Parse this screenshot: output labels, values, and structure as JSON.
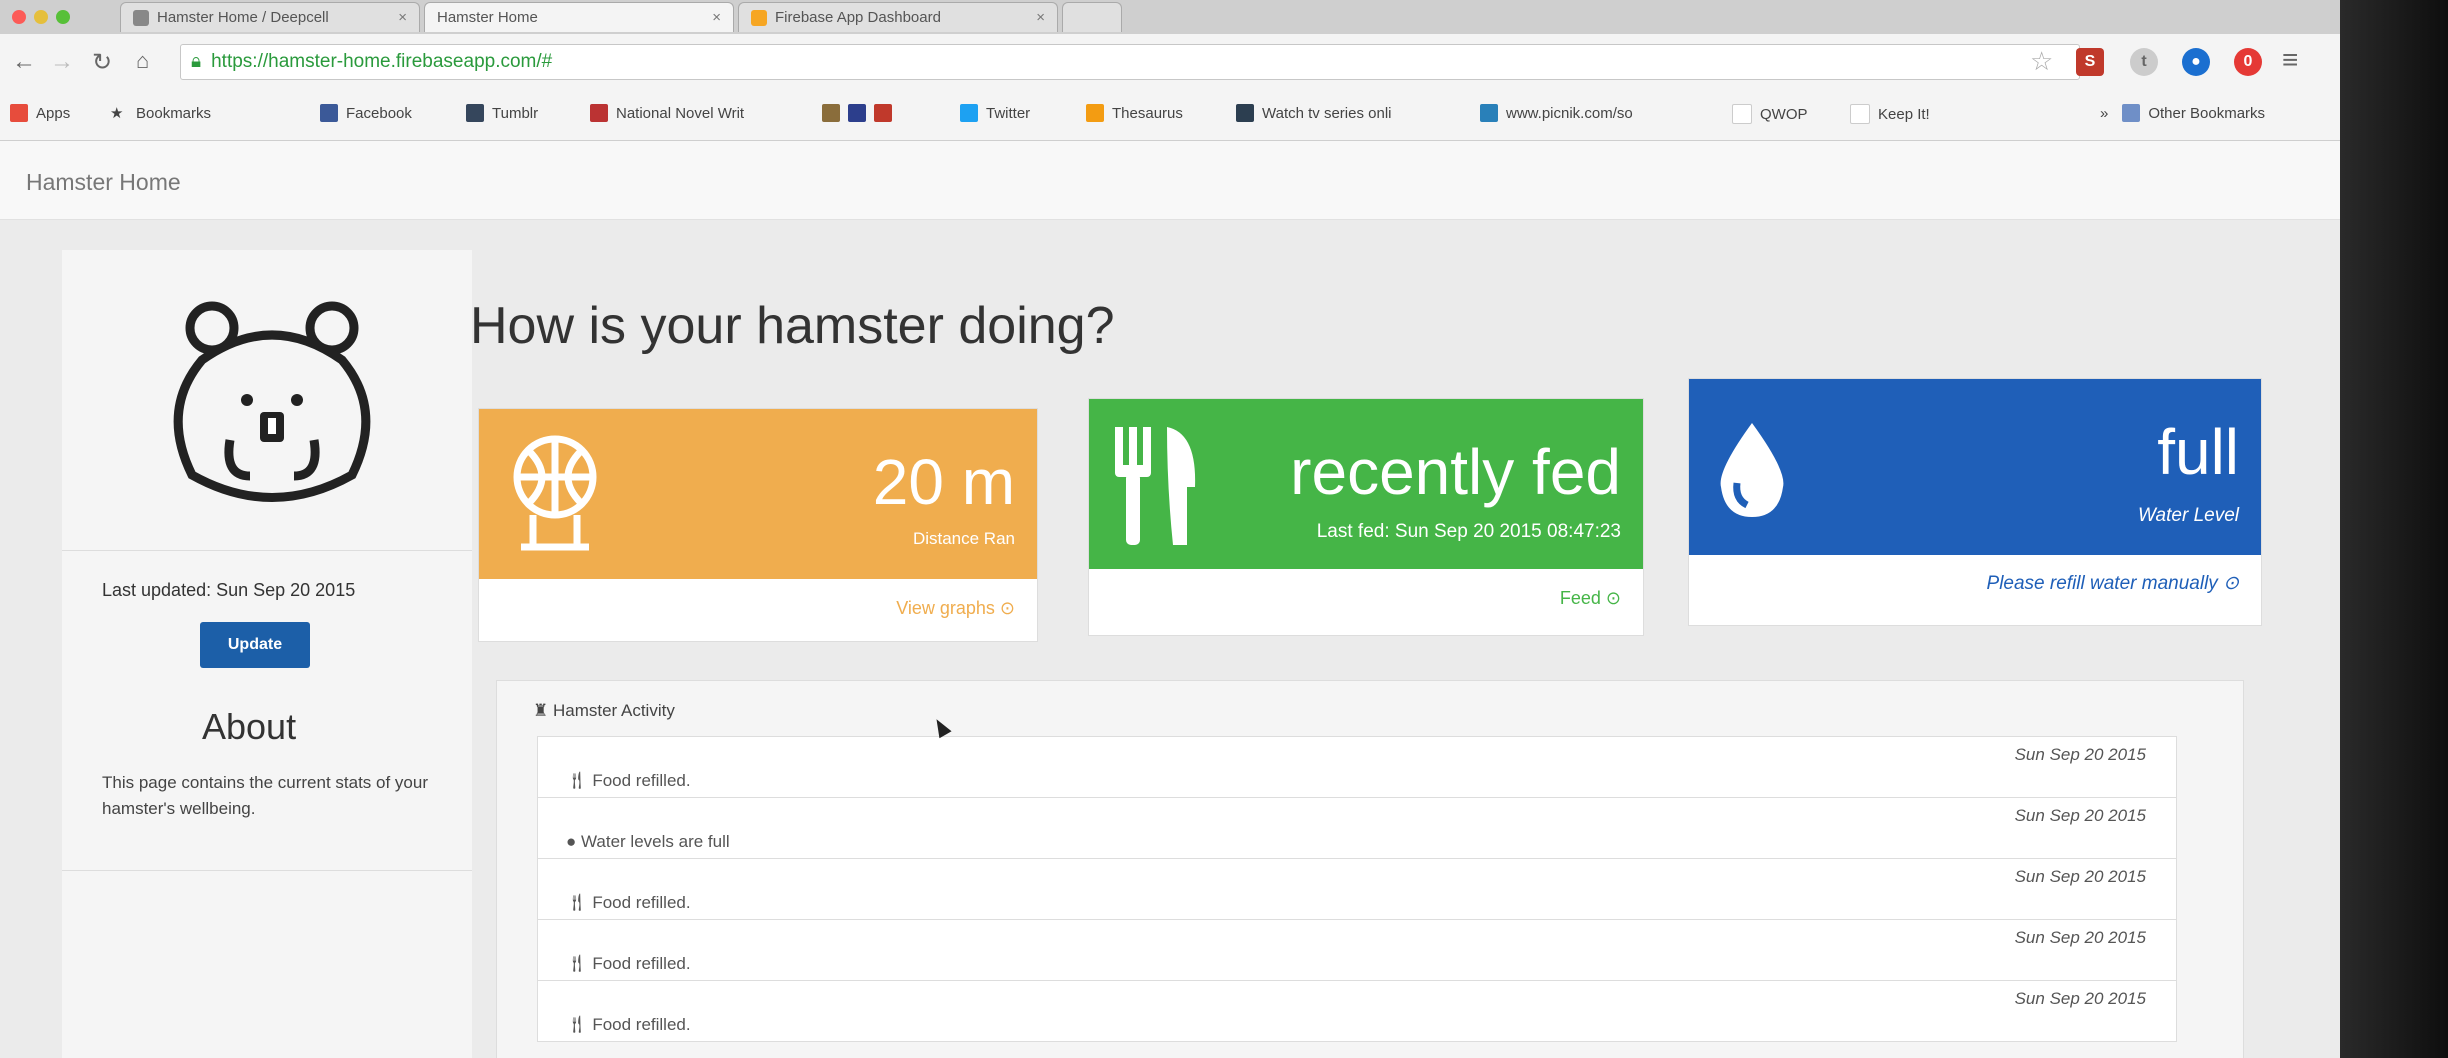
{
  "browser": {
    "tabs": [
      {
        "title": "Hamster Home / Deepcell",
        "active": false
      },
      {
        "title": "Hamster Home",
        "active": true
      },
      {
        "title": "Firebase App Dashboard",
        "active": false
      }
    ],
    "url": "https://hamster-home.firebaseapp.com/#",
    "bookmarks": [
      "Apps",
      "Bookmarks",
      "Facebook",
      "Tumblr",
      "National Novel Writ",
      "Twitter",
      "Thesaurus",
      "Watch tv series onli",
      "www.picnik.com/so",
      "QWOP",
      "Keep It!",
      "Other Bookmarks"
    ]
  },
  "app": {
    "brand": "Hamster Home"
  },
  "sidebar": {
    "last_updated": "Last updated: Sun Sep 20 2015",
    "update_label": "Update",
    "about_title": "About",
    "about_text": "This page contains the current stats of your hamster's wellbeing."
  },
  "main": {
    "title": "How is your hamster doing?",
    "cards": {
      "distance": {
        "value": "20 m",
        "label": "Distance Ran",
        "link": "View graphs ⊙",
        "color": "#f0ad4e"
      },
      "food": {
        "value": "recently fed",
        "label": "Last fed: Sun Sep 20 2015 08:47:23",
        "link": "Feed ⊙",
        "color": "#45b547"
      },
      "water": {
        "value": "full",
        "label": "Water Level",
        "link": "Please refill water manually ⊙",
        "color": "#1f5fb8"
      }
    },
    "activity": {
      "title": "Hamster Activity",
      "rows": [
        {
          "icon": "food-icon",
          "text": "Food refilled.",
          "date": "Sun Sep 20 2015"
        },
        {
          "icon": "water-icon",
          "text": "Water levels are full",
          "date": "Sun Sep 20 2015"
        },
        {
          "icon": "food-icon",
          "text": "Food refilled.",
          "date": "Sun Sep 20 2015"
        },
        {
          "icon": "food-icon",
          "text": "Food refilled.",
          "date": "Sun Sep 20 2015"
        },
        {
          "icon": "food-icon",
          "text": "Food refilled.",
          "date": "Sun Sep 20 2015"
        }
      ]
    }
  }
}
